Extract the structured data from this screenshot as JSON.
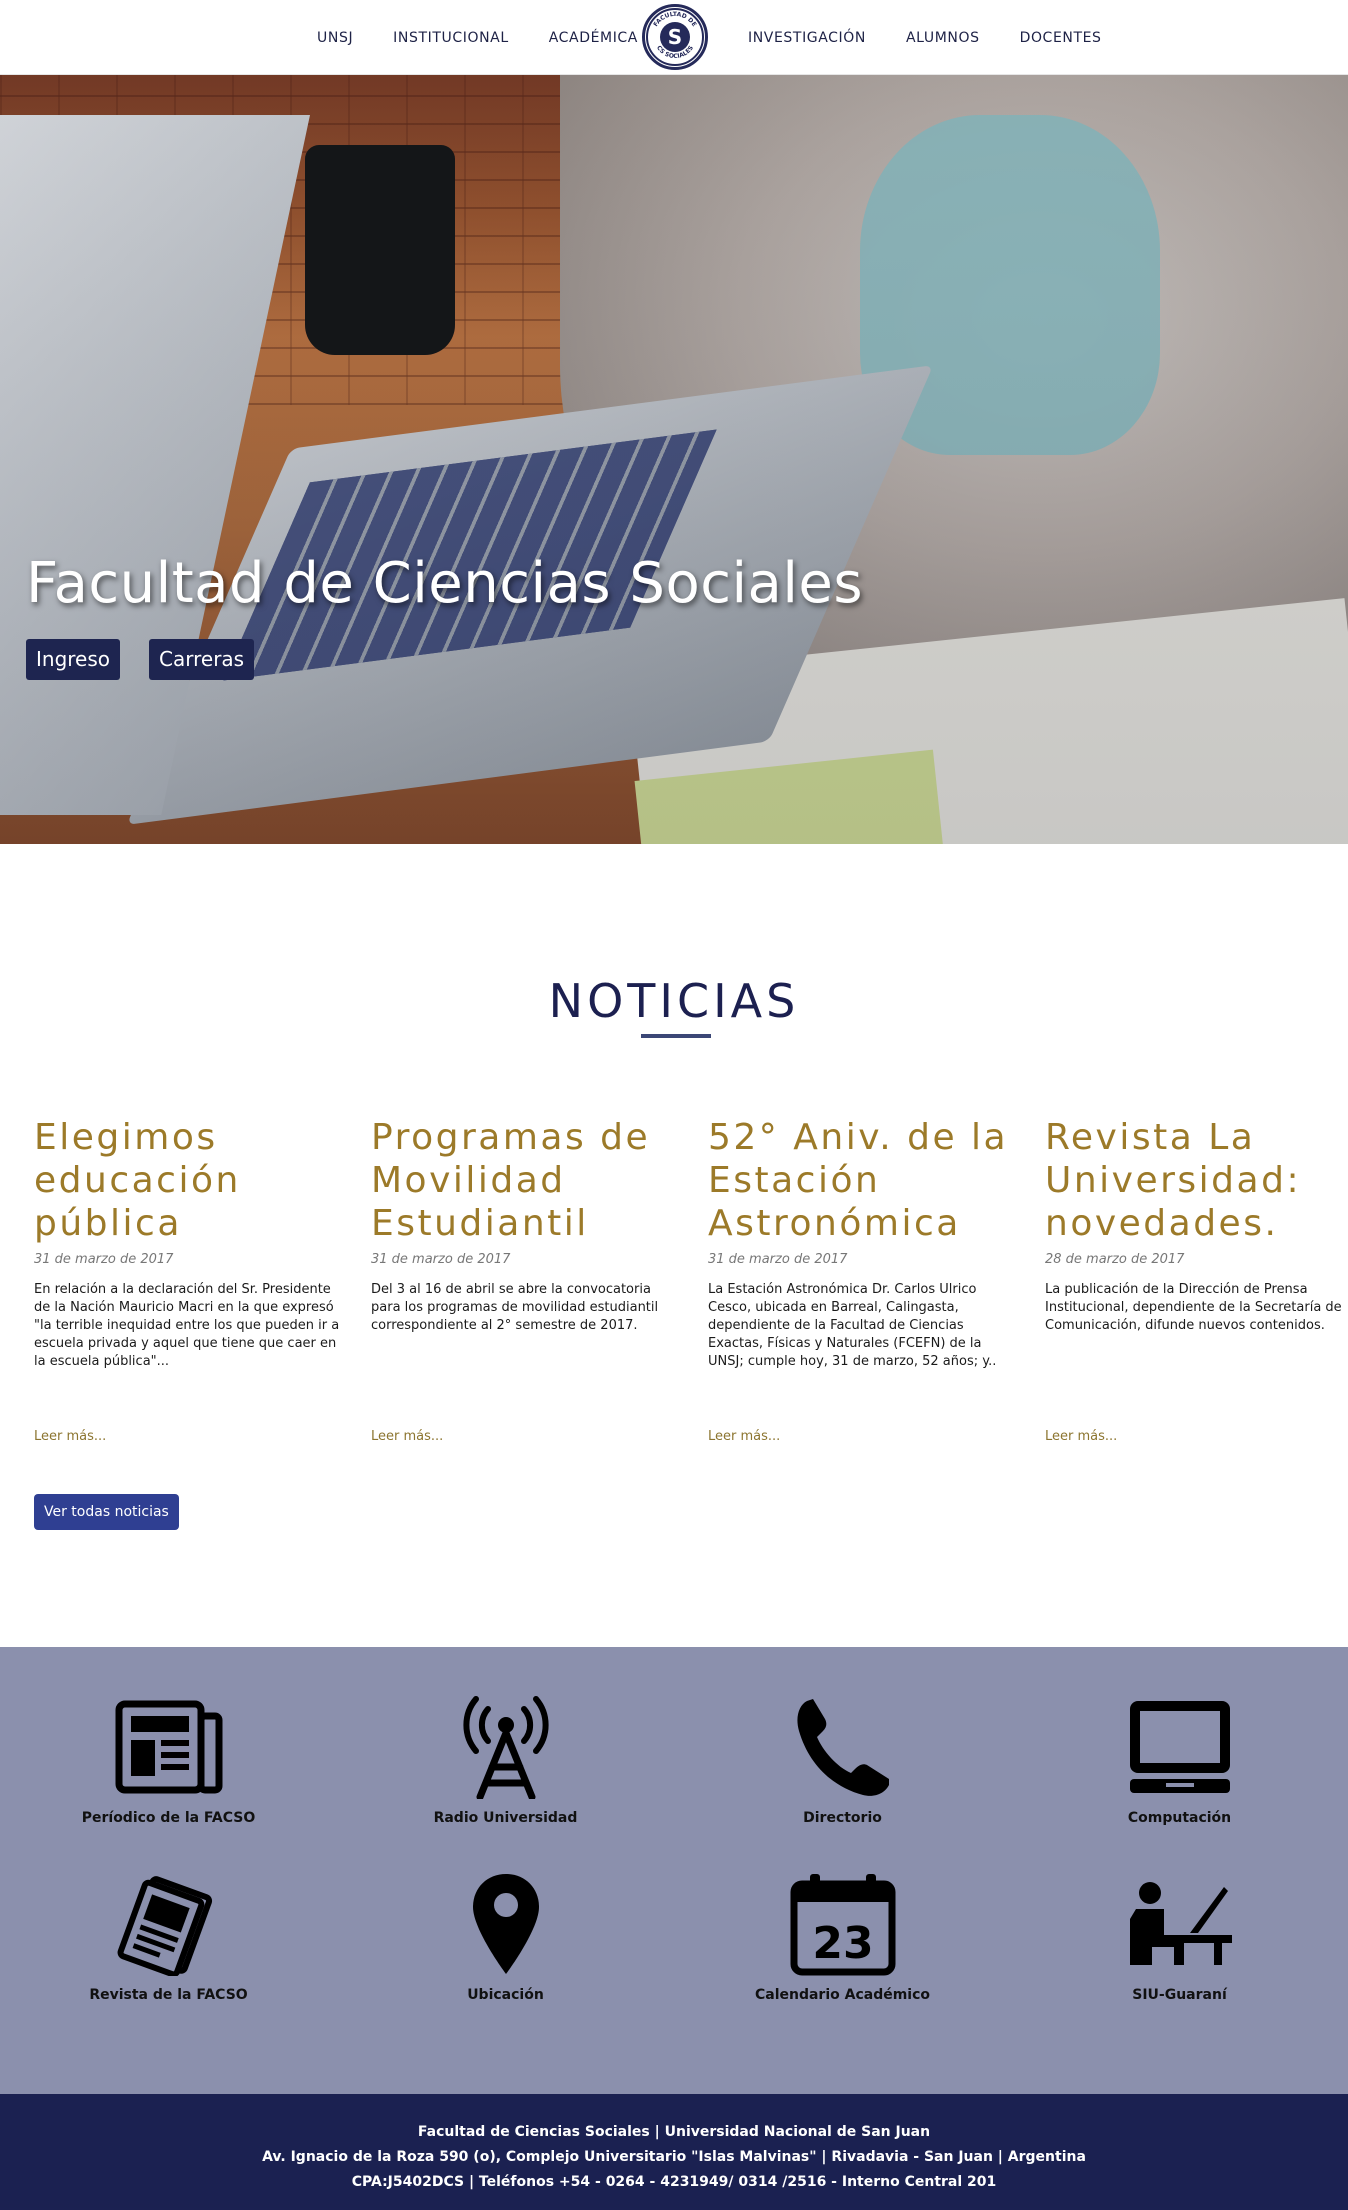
{
  "nav": {
    "left_items": [
      {
        "label": "UNSJ"
      },
      {
        "label": "INSTITUCIONAL"
      },
      {
        "label": "ACADÉMICA"
      }
    ],
    "right_items": [
      {
        "label": "INVESTIGACIÓN"
      },
      {
        "label": "ALUMNOS"
      },
      {
        "label": "DOCENTES"
      }
    ],
    "logo_text_top": "FACULTAD DE",
    "logo_text_bottom": "CS SOCIALES",
    "logo_letter": "S"
  },
  "hero": {
    "title": "Facultad de Ciencias Sociales",
    "buttons": [
      {
        "label": "Ingreso"
      },
      {
        "label": "Carreras"
      }
    ]
  },
  "news": {
    "section_title": "NOTICIAS",
    "items": [
      {
        "title": "Elegimos educación pública",
        "date": "31 de marzo de 2017",
        "body": "En relación a la declaración del Sr. Presidente de la Nación Mauricio Macri en la que expresó \"la terrible inequidad entre los que pueden ir a escuela privada y aquel que tiene que caer en la escuela pública\"...",
        "more": "Leer más..."
      },
      {
        "title": "Programas de Movilidad Estudiantil",
        "date": "31 de marzo de 2017",
        "body": "Del 3 al 16 de abril se abre la convocatoria para los programas de movilidad estudiantil correspondiente al 2° semestre de 2017.",
        "more": "Leer más..."
      },
      {
        "title": "52° Aniv. de la Estación Astronómica",
        "date": "31 de marzo de 2017",
        "body": "La Estación Astronómica Dr. Carlos Ulrico Cesco, ubicada en Barreal, Calingasta, dependiente de la Facultad de Ciencias Exactas, Físicas y Naturales (FCEFN) de la UNSJ; cumple hoy, 31 de marzo, 52 años; y..",
        "more": "Leer más..."
      },
      {
        "title": "Revista La Universidad: novedades.",
        "date": "28 de marzo de 2017",
        "body": "La publicación de la Dirección de Prensa Institucional, dependiente de la Secretaría de Comunicación, difunde nuevos contenidos.",
        "more": "Leer más..."
      }
    ],
    "all_button": "Ver todas noticias"
  },
  "links": [
    {
      "label": "Períodico de la FACSO",
      "icon": "newspaper-icon"
    },
    {
      "label": "Radio Universidad",
      "icon": "radio-tower-icon"
    },
    {
      "label": "Directorio",
      "icon": "phone-icon"
    },
    {
      "label": "Computación",
      "icon": "computer-icon"
    },
    {
      "label": "Revista de la FACSO",
      "icon": "magazine-icon"
    },
    {
      "label": "Ubicación",
      "icon": "map-pin-icon"
    },
    {
      "label": "Calendario Académico",
      "icon": "calendar-icon",
      "icon_text": "23"
    },
    {
      "label": "SIU-Guaraní",
      "icon": "student-desk-icon"
    }
  ],
  "footer": {
    "lines": [
      "Facultad de Ciencias Sociales | Universidad Nacional de San Juan",
      "Av. Ignacio de la Roza 590 (o), Complejo Universitario \"Islas Malvinas\" | Rivadavia - San Juan | Argentina",
      "CPA:J5402DCS | Teléfonos +54 - 0264 - 4231949/ 0314 /2516 - Interno Central 201"
    ]
  },
  "colors": {
    "navy": "#1b2151",
    "gold": "#9c7a29",
    "button_blue": "#2f3f92",
    "links_bg": "#8b90ad"
  }
}
